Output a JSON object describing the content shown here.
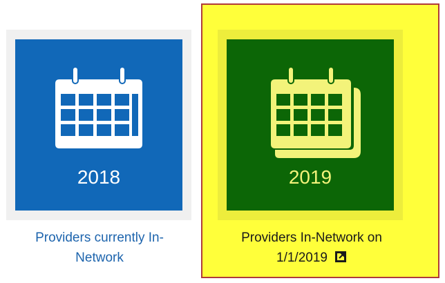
{
  "cards": [
    {
      "year": "2018",
      "caption_line1": "Providers currently In-",
      "caption_line2": "Network",
      "icon": "calendar-icon",
      "tile_color": "#1168b8",
      "icon_color": "#ffffff"
    },
    {
      "year": "2019",
      "caption_line1": "Providers In-Network on",
      "caption_line2": "1/1/2019",
      "icon": "calendar-stack-icon",
      "caption_icon": "external-link-icon",
      "tile_color": "#0c6606",
      "icon_color": "#f3f37a",
      "highlight_color": "#ffff3a",
      "highlight_border": "#b03a3a"
    }
  ]
}
